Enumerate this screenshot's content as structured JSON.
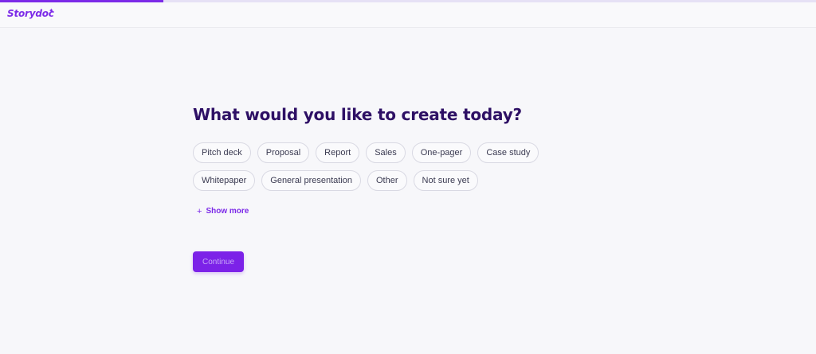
{
  "progress": {
    "fraction": 0.2
  },
  "brand": {
    "name": "Storydoc",
    "spark": "✦",
    "color": "#7c2ae8"
  },
  "question": {
    "title": "What would you like to create today?"
  },
  "options": [
    "Pitch deck",
    "Proposal",
    "Report",
    "Sales",
    "One-pager",
    "Case study",
    "Whitepaper",
    "General presentation",
    "Other",
    "Not sure yet"
  ],
  "show_more": {
    "icon": "plus-icon",
    "label": "Show more"
  },
  "continue_button": {
    "label": "Continue"
  }
}
